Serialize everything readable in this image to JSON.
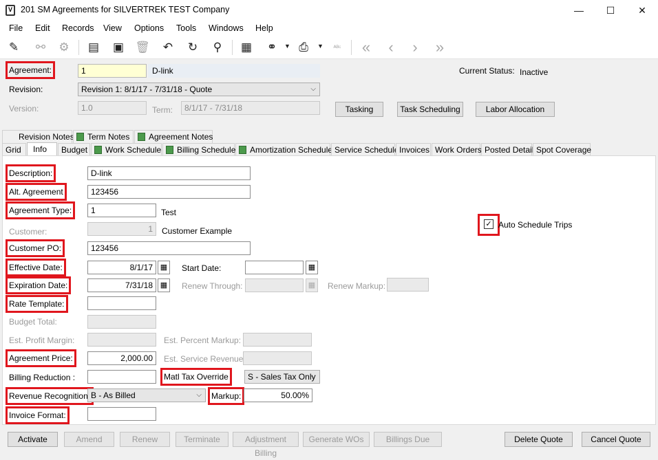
{
  "window": {
    "title": "201 SM Agreements for SILVERTREK TEST Company",
    "app_icon_letter": "V",
    "minimize": "—",
    "maximize": "☐",
    "close": "✕"
  },
  "menu": [
    "File",
    "Edit",
    "Records",
    "View",
    "Options",
    "Tools",
    "Windows",
    "Help"
  ],
  "toolbar": {
    "icons": [
      {
        "name": "edit-checklist-icon",
        "glyph": "✎",
        "enabled": true
      },
      {
        "name": "binoculars-icon",
        "glyph": "⚯",
        "enabled": false
      },
      {
        "name": "settings-gear-icon",
        "glyph": "⚙",
        "enabled": false
      },
      {
        "name": "new-document-icon",
        "glyph": "▤",
        "enabled": true
      },
      {
        "name": "save-icon",
        "glyph": "▣",
        "enabled": true
      },
      {
        "name": "delete-trash-icon",
        "glyph": "🗑",
        "enabled": false
      },
      {
        "name": "undo-icon",
        "glyph": "↶",
        "enabled": true
      },
      {
        "name": "refresh-icon",
        "glyph": "↻",
        "enabled": true
      },
      {
        "name": "search-icon",
        "glyph": "⚲",
        "enabled": true
      },
      {
        "name": "calculator-icon",
        "glyph": "▦",
        "enabled": true
      },
      {
        "name": "attachment-icon",
        "glyph": "⚭",
        "enabled": true
      },
      {
        "name": "print-icon",
        "glyph": "⎙",
        "enabled": true
      },
      {
        "name": "spellcheck-icon",
        "glyph": "ᴬᴮᶜ",
        "enabled": false
      },
      {
        "name": "first-record-icon",
        "glyph": "«",
        "enabled": false
      },
      {
        "name": "previous-record-icon",
        "glyph": "‹",
        "enabled": false
      },
      {
        "name": "next-record-icon",
        "glyph": "›",
        "enabled": false
      },
      {
        "name": "last-record-icon",
        "glyph": "»",
        "enabled": false
      }
    ]
  },
  "header": {
    "agreement_label": "Agreement:",
    "agreement_value": "1",
    "agreement_desc": "D-link",
    "current_status_label": "Current Status:",
    "current_status_value": "Inactive",
    "revision_label": "Revision:",
    "revision_value": "Revision 1: 8/1/17 - 7/31/18  -  Quote",
    "version_label": "Version:",
    "version_value": "1.0",
    "term_label": "Term:",
    "term_value": "8/1/17 - 7/31/18",
    "tasking_button": "Tasking",
    "task_scheduling_button": "Task Scheduling",
    "labor_allocation_button": "Labor Allocation"
  },
  "tabs_row1": [
    "Revision Notes",
    "Term Notes",
    "Agreement Notes"
  ],
  "tabs_row2": [
    "Grid",
    "Info",
    "Budget",
    "Work Schedule",
    "Billing Schedule",
    "Amortization Schedule",
    "Service Schedule",
    "Invoices",
    "Work Orders",
    "Posted Detail",
    "Spot Coverage"
  ],
  "info": {
    "description_label": "Description:",
    "description_value": "D-link",
    "alt_agreement_label": "Alt. Agreement",
    "alt_agreement_value": "123456",
    "agreement_type_label": "Agreement Type:",
    "agreement_type_value": "1",
    "agreement_type_desc": "Test",
    "customer_label": "Customer:",
    "customer_value": "1",
    "customer_desc": "Customer Example",
    "customer_po_label": "Customer PO:",
    "customer_po_value": "123456",
    "effective_date_label": "Effective Date:",
    "effective_date_value": "8/1/17",
    "start_date_label": "Start Date:",
    "start_date_value": "",
    "expiration_date_label": "Expiration Date:",
    "expiration_date_value": "7/31/18",
    "renew_through_label": "Renew Through:",
    "renew_markup_label": "Renew Markup:",
    "rate_template_label": "Rate Template:",
    "budget_total_label": "Budget Total:",
    "est_profit_margin_label": "Est. Profit Margin:",
    "est_percent_markup_label": "Est. Percent Markup:",
    "agreement_price_label": "Agreement Price:",
    "agreement_price_value": "2,000.00",
    "est_service_revenue_label": "Est. Service Revenue:",
    "billing_reduction_label": "Billing Reduction :",
    "matl_tax_override_label": "Matl Tax Override",
    "matl_tax_override_value": "S - Sales Tax Only",
    "revenue_recognition_label": "Revenue Recognition:",
    "revenue_recognition_value": "B - As Billed",
    "markup_label": "Markup:",
    "markup_value": "50.00%",
    "invoice_format_label": "Invoice Format:",
    "auto_schedule_label": "Auto Schedule Trips",
    "auto_schedule_checked": "✓"
  },
  "footer": {
    "activate": "Activate",
    "amend": "Amend",
    "renew": "Renew",
    "terminate": "Terminate",
    "adjustment_billing": "Adjustment Billing",
    "generate_wos": "Generate WOs",
    "billings_due": "Billings Due",
    "delete_quote": "Delete Quote",
    "cancel_quote": "Cancel Quote"
  },
  "colors": {
    "highlight": "#e0161d",
    "tab_icon": "#4c9a4c"
  }
}
